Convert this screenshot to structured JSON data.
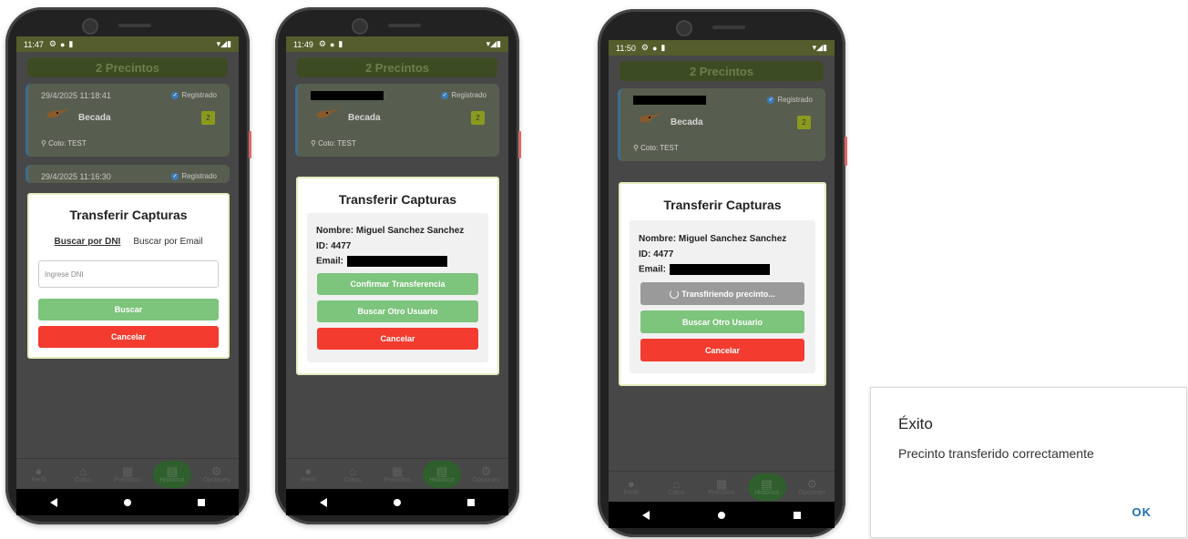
{
  "phone1": {
    "status": {
      "time": "11:47"
    },
    "header": "2 Precintos",
    "cards": [
      {
        "date": "29/4/2025 11:18:41",
        "status": "Registrado",
        "species": "Becada",
        "count": "2",
        "coto": "Coto: TEST"
      },
      {
        "date": "29/4/2025 11:16:30",
        "status": "Registrado"
      }
    ],
    "modal": {
      "title": "Transferir Capturas",
      "tab_dni": "Buscar por DNI",
      "tab_email": "Buscar por Email",
      "input_placeholder": "Ingrese DNI",
      "search_btn": "Buscar",
      "cancel_btn": "Cancelar"
    }
  },
  "phone2": {
    "status": {
      "time": "11:49"
    },
    "header": "2 Precintos",
    "cards": [
      {
        "status": "Registrado",
        "species": "Becada",
        "count": "2",
        "coto": "Coto: TEST"
      }
    ],
    "modal": {
      "title": "Transferir Capturas",
      "nombre": "Nombre: Miguel Sanchez Sanchez",
      "id": "ID: 4477",
      "email_label": "Email:",
      "confirm_btn": "Confirmar Transferencia",
      "other_btn": "Buscar Otro Usuario",
      "cancel_btn": "Cancelar"
    }
  },
  "phone3": {
    "status": {
      "time": "11:50"
    },
    "header": "2 Precintos",
    "cards": [
      {
        "status": "Registrado",
        "species": "Becada",
        "count": "2",
        "coto": "Coto: TEST"
      }
    ],
    "modal": {
      "title": "Transferir Capturas",
      "nombre": "Nombre: Miguel Sanchez Sanchez",
      "id": "ID: 4477",
      "email_label": "Email:",
      "loading_btn": "Transfiriendo precinto...",
      "other_btn": "Buscar Otro Usuario",
      "cancel_btn": "Cancelar"
    }
  },
  "tabs": [
    "Perfil",
    "Cotos",
    "Precintos",
    "Histórico",
    "Opciones"
  ],
  "dialog": {
    "title": "Éxito",
    "message": "Precinto transferido correctamente",
    "ok": "OK"
  }
}
